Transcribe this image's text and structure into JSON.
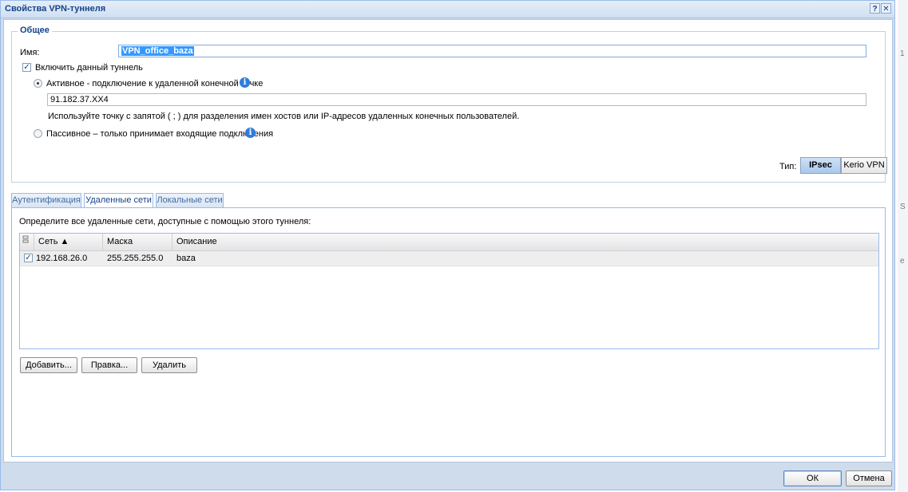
{
  "dialog": {
    "title": "Свойства VPN-туннеля",
    "help_label": "?",
    "close_label": "✕"
  },
  "general": {
    "legend": "Общее",
    "name_label": "Имя:",
    "name_value": "VPN_office_baza",
    "enable_label": "Включить данный туннель",
    "enable_checked": true,
    "active_label": "Активное - подключение к удаленной конечной точке",
    "endpoint_value": "91.182.37.XX4",
    "hint": "Используйте точку с запятой ( ; ) для разделения имен хостов или IP-адресов удаленных конечных пользователей.",
    "passive_label": "Пассивное – только принимает входящие подключения",
    "type_label": "Тип:",
    "type_options": [
      "IPsec",
      "Kerio VPN"
    ],
    "type_selected": "IPsec",
    "info_glyph": "i"
  },
  "tabs": [
    "Аутентификация",
    "Удаленные сети",
    "Локальные сети"
  ],
  "active_tab": "Удаленные сети",
  "remote_networks": {
    "description": "Определите все удаленные сети, доступные с помощью этого туннеля:",
    "columns": [
      "Сеть ▲",
      "Маска",
      "Описание"
    ],
    "rows": [
      {
        "checked": true,
        "network": "192.168.26.0",
        "mask": "255.255.255.0",
        "description": "baza"
      }
    ],
    "buttons": {
      "add": "Добавить...",
      "edit": "Правка...",
      "delete": "Удалить"
    }
  },
  "footer": {
    "ok": "ОК",
    "cancel": "Отмена"
  },
  "side_marks": [
    "1",
    "S",
    "e"
  ],
  "colors": {
    "title_text": "#15428b",
    "selection": "#3399ff",
    "info": "#2f7dd9",
    "frame": "#cfdceb"
  }
}
